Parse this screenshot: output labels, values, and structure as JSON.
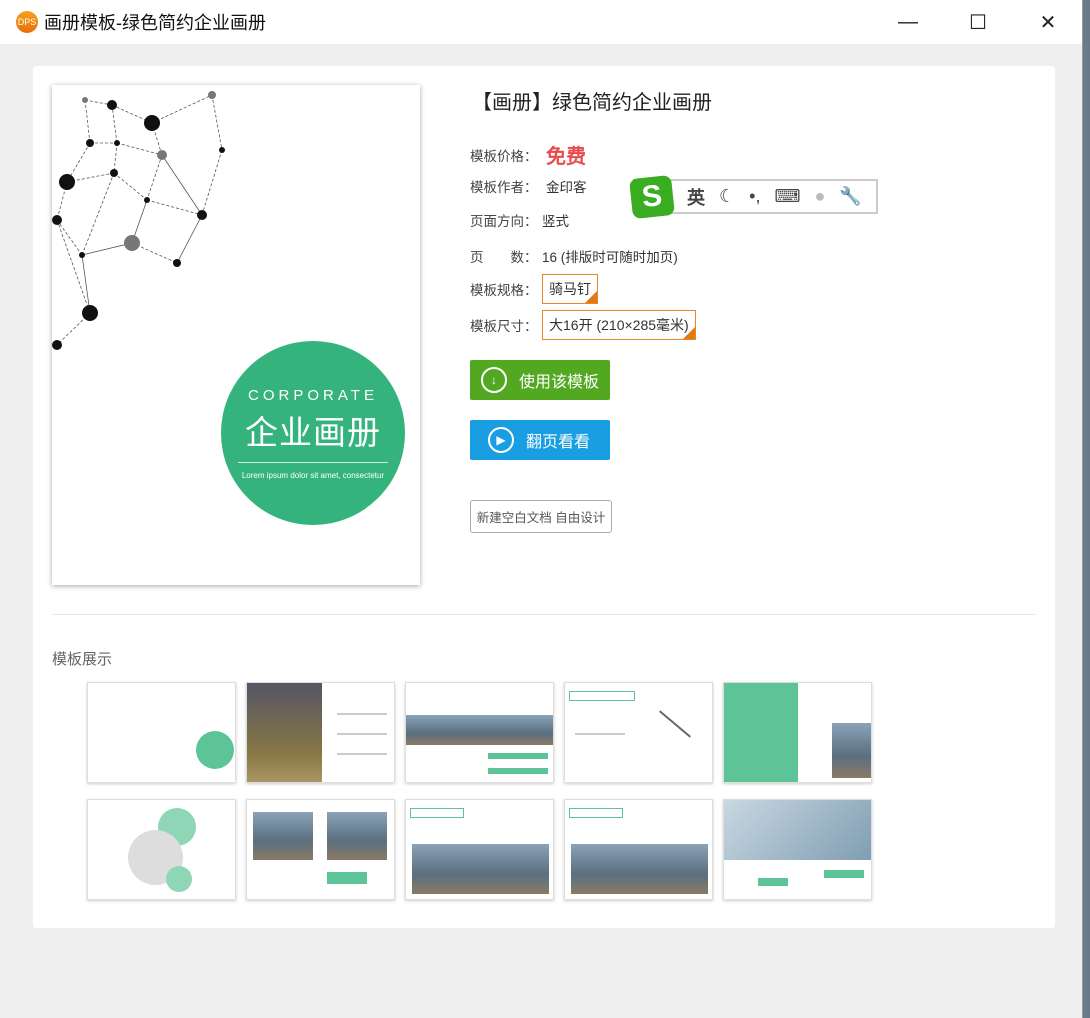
{
  "window": {
    "logo_text": "DPS",
    "title": "画册模板-绿色简约企业画册",
    "minimize": "—",
    "maximize": "☐",
    "close": "✕"
  },
  "cover": {
    "heading_en": "CORPORATE",
    "heading_cn": "企业画册",
    "subtitle": "Lorem ipsum dolor sit amet, consectetur",
    "accent": "#34b37c"
  },
  "details": {
    "title": "【画册】绿色简约企业画册",
    "price_label": "模板价格：",
    "price": "免费",
    "author_label": "模板作者：",
    "author": "金印客",
    "orientation_label": "页面方向：",
    "orientation": "竖式",
    "pages_label": "页　　数：",
    "pages": "16 (排版时可随时加页)",
    "spec_label": "模板规格：",
    "spec": "骑马钉",
    "size_label": "模板尺寸：",
    "size": "大16开 (210×285毫米)"
  },
  "buttons": {
    "use": "使用该模板",
    "preview": "翻页看看",
    "blank": "新建空白文档 自由设计",
    "use_color": "#52a820",
    "preview_color": "#1a9ee2"
  },
  "ime": {
    "mode": "英",
    "icons": [
      "sogou-logo-icon",
      "moon-icon",
      "punctuation-icon",
      "keyboard-icon",
      "user-icon",
      "wrench-icon"
    ]
  },
  "gallery": {
    "title": "模板展示",
    "count": 10
  }
}
